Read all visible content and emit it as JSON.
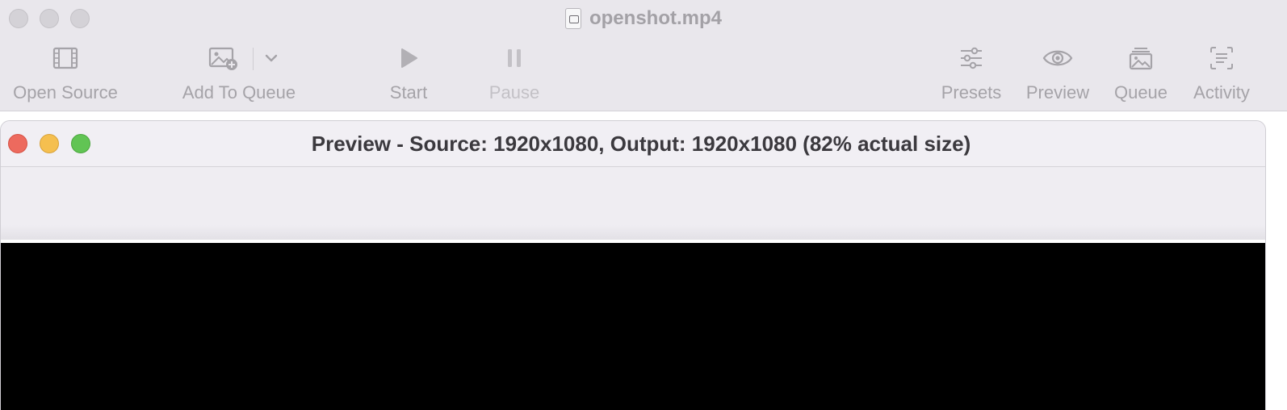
{
  "main_window": {
    "title": "openshot.mp4",
    "toolbar": {
      "open_source": "Open Source",
      "add_to_queue": "Add To Queue",
      "start": "Start",
      "pause": "Pause",
      "presets": "Presets",
      "preview": "Preview",
      "queue": "Queue",
      "activity": "Activity"
    }
  },
  "preview_window": {
    "title": "Preview - Source: 1920x1080, Output: 1920x1080 (82% actual size)"
  },
  "colors": {
    "close": "#ed6a5e",
    "minimize": "#f5bf4f",
    "maximize": "#61c454",
    "video_background": "#000000"
  }
}
